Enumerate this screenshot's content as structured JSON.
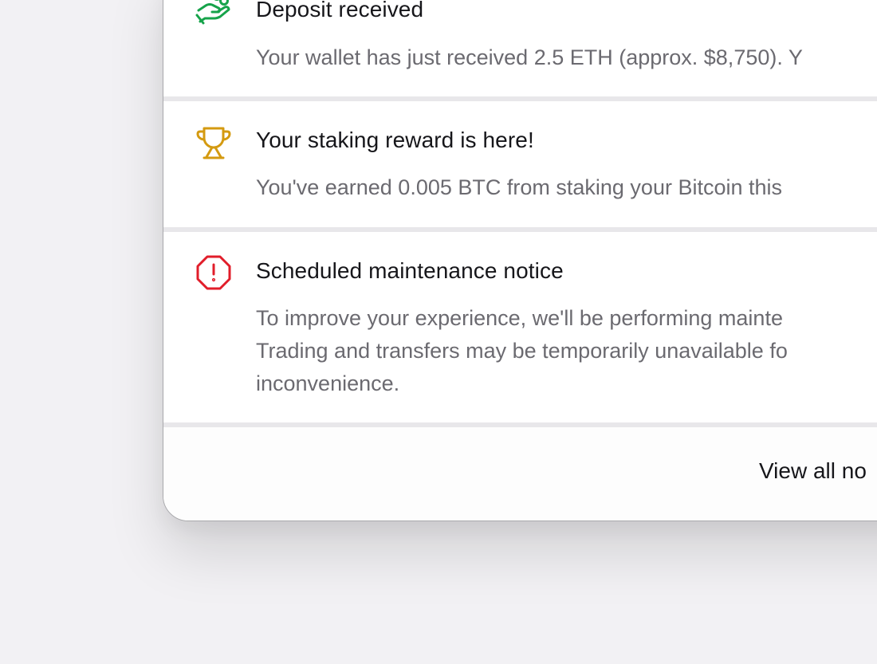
{
  "notifications": [
    {
      "icon": "hand-coins-icon",
      "color": "#16a34a",
      "title": "Deposit received",
      "body_lines": [
        "Your wallet has just received 2.5 ETH (approx. $8,750). Y"
      ]
    },
    {
      "icon": "trophy-icon",
      "color": "#d49a10",
      "title": "Your staking reward is here!",
      "body_lines": [
        "You've earned 0.005 BTC from staking your Bitcoin this"
      ]
    },
    {
      "icon": "alert-octagon-icon",
      "color": "#e11d2a",
      "title": "Scheduled maintenance notice",
      "body_lines": [
        "To improve your experience, we'll be performing mainte",
        "Trading and transfers may be temporarily unavailable fo",
        "inconvenience."
      ]
    }
  ],
  "footer": {
    "view_all_label": "View all no"
  }
}
